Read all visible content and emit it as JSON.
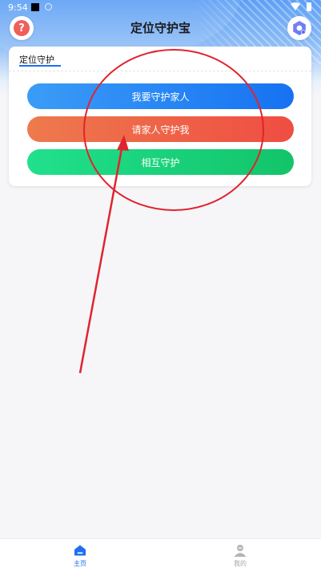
{
  "status_bar": {
    "time": "9:54"
  },
  "header": {
    "title": "定位守护宝",
    "help_icon_glyph": "?"
  },
  "card": {
    "title": "定位守护",
    "buttons": [
      {
        "label": "我要守护家人"
      },
      {
        "label": "请家人守护我"
      },
      {
        "label": "相互守护"
      }
    ]
  },
  "bottom_nav": {
    "items": [
      {
        "label": "主页",
        "active": true
      },
      {
        "label": "我的",
        "active": false
      }
    ]
  },
  "colors": {
    "accent": "#1d6ff2",
    "blue_button": "#1672f2",
    "red_button": "#ef4d42",
    "green_button": "#12c46a",
    "annotation": "#e0242f"
  },
  "icons": {
    "help": "help-icon",
    "settings": "settings-icon",
    "home": "home-icon",
    "profile": "profile-icon"
  }
}
